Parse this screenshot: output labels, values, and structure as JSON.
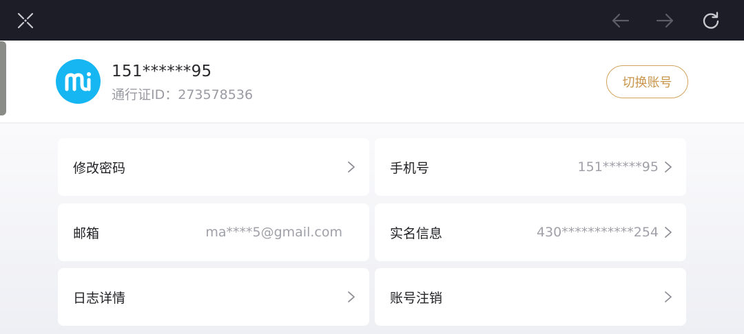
{
  "topbar": {
    "close_icon": "close-icon",
    "back_icon": "arrow-left-icon",
    "forward_icon": "arrow-right-icon",
    "refresh_icon": "refresh-icon"
  },
  "profile": {
    "avatar_text": "mi",
    "username": "151******95",
    "pass_id": "通行证ID：273578536",
    "switch_account": "切换账号"
  },
  "settings": {
    "change_password": {
      "label": "修改密码"
    },
    "phone": {
      "label": "手机号",
      "value": "151******95"
    },
    "email": {
      "label": "邮箱",
      "value": "ma****5@gmail.com"
    },
    "real_name": {
      "label": "实名信息",
      "value": "430***********254"
    },
    "log_details": {
      "label": "日志详情"
    },
    "delete_account": {
      "label": "账号注销"
    }
  },
  "colors": {
    "topbar": "#1c1d26",
    "avatar": "#16b6f2",
    "accent": "#d1a25c"
  }
}
